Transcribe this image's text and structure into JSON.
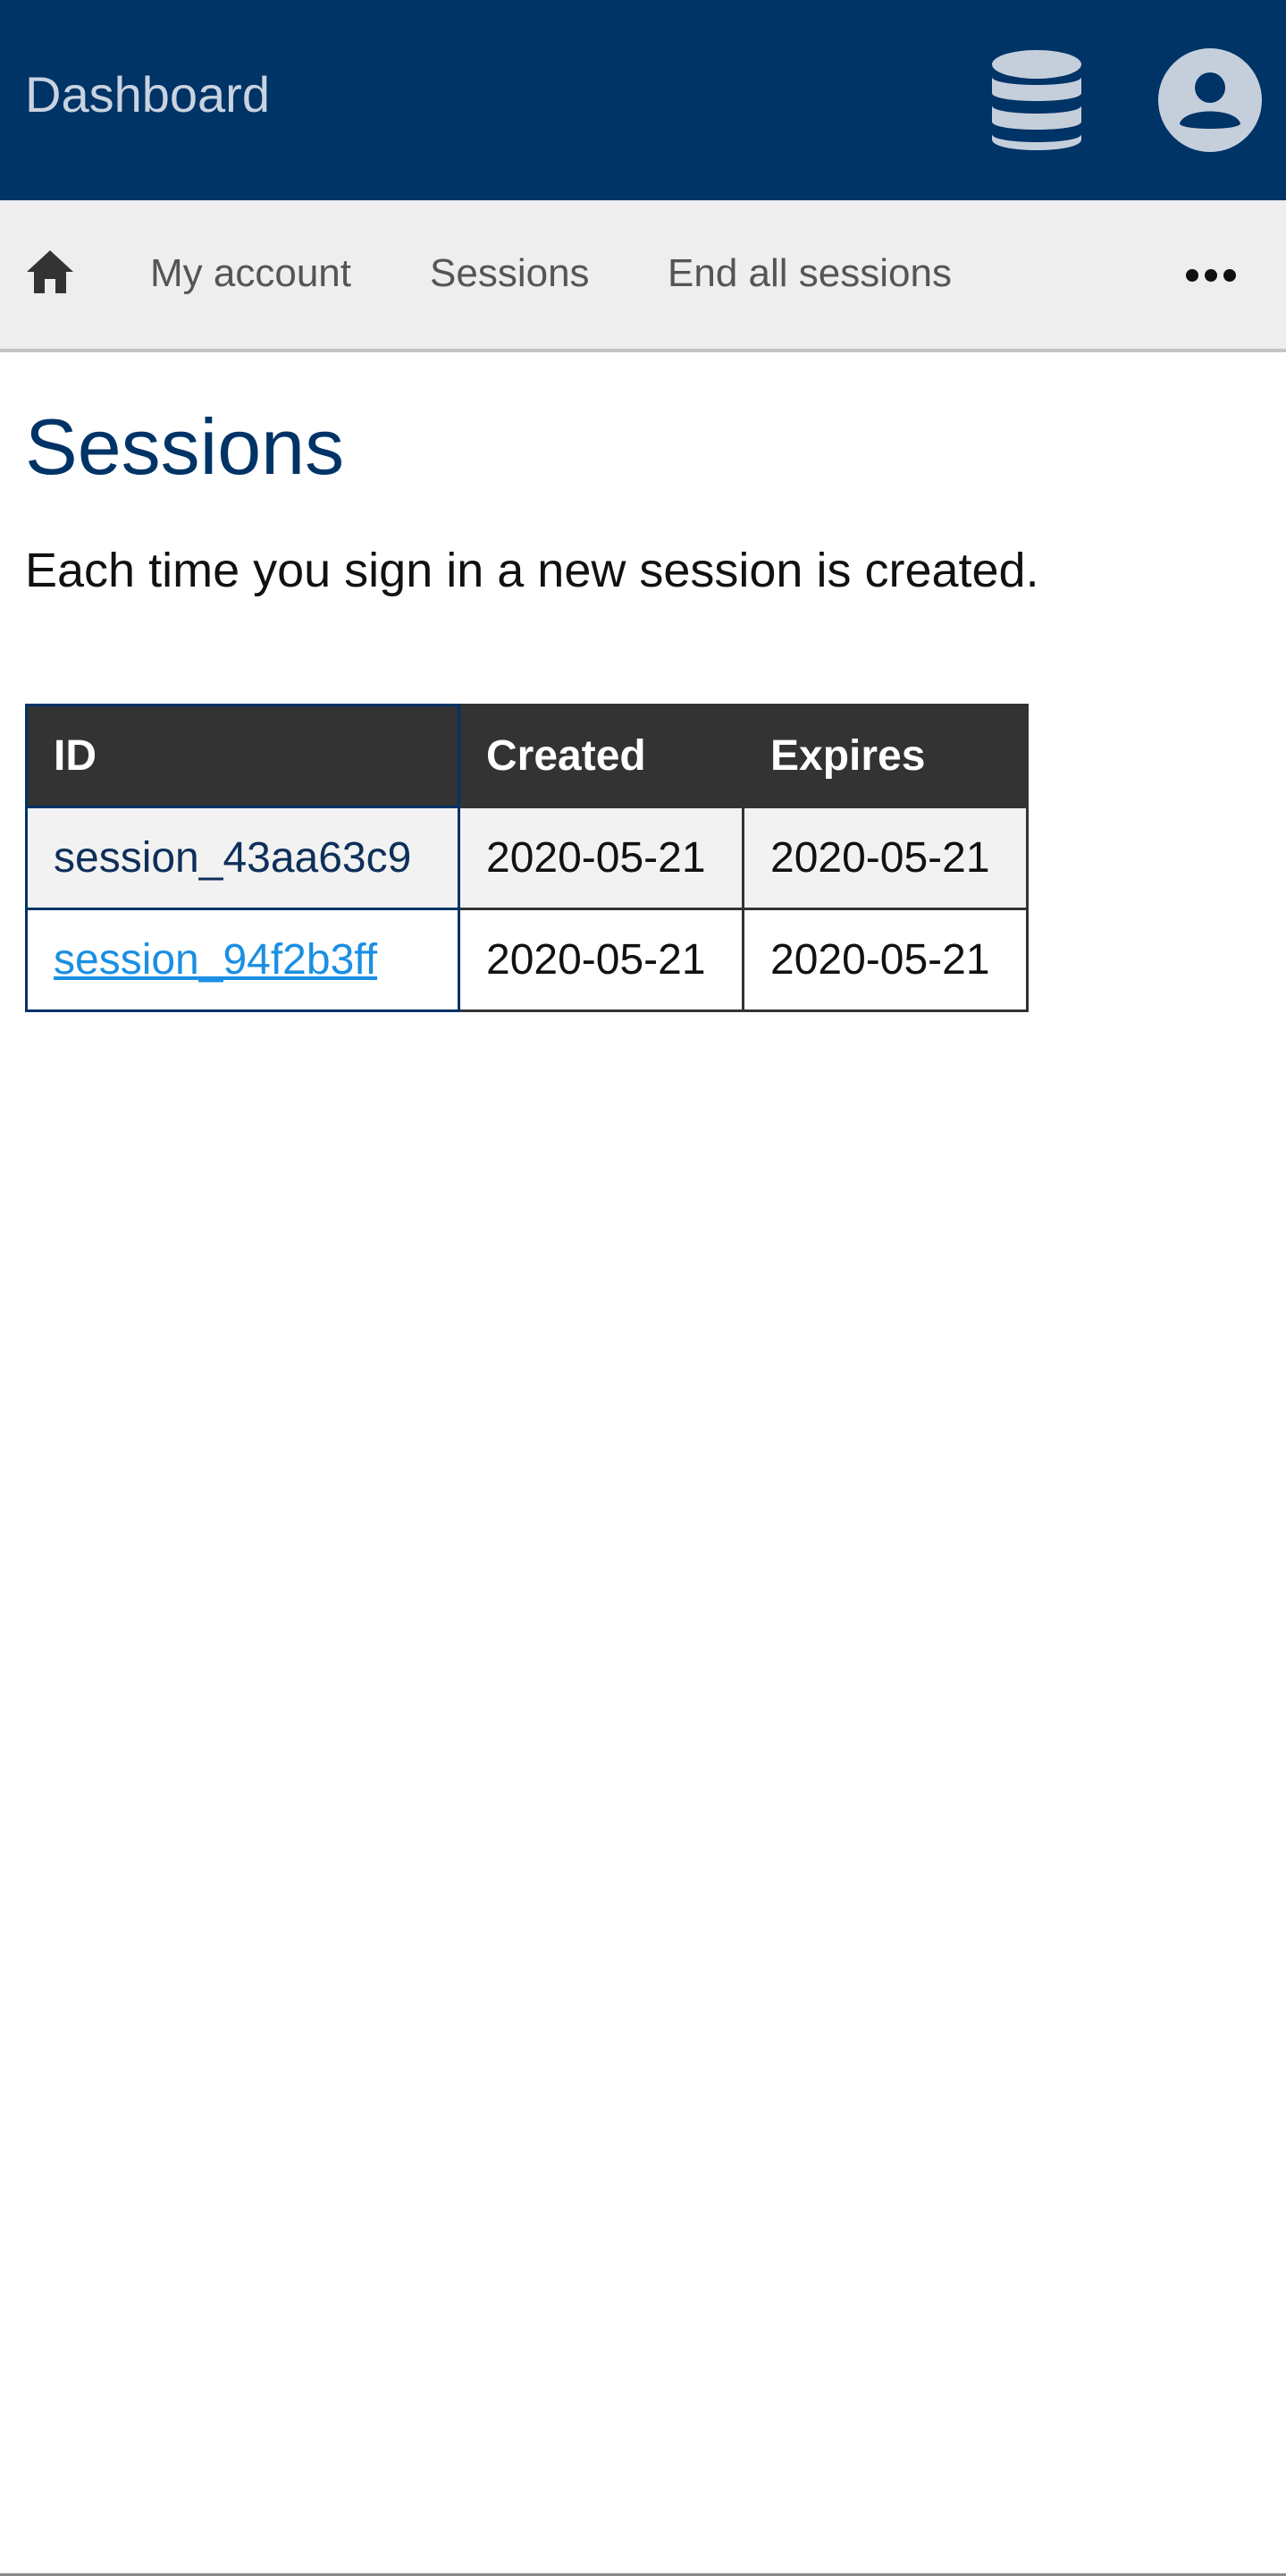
{
  "header": {
    "brand": "Dashboard",
    "database_icon": "database-icon",
    "user_icon": "user-circle-icon"
  },
  "nav": {
    "home_icon": "home-icon",
    "items": [
      {
        "label": "My account"
      },
      {
        "label": "Sessions"
      },
      {
        "label": "End all sessions"
      }
    ],
    "more_icon": "more-horizontal-icon"
  },
  "main": {
    "title": "Sessions",
    "intro": "Each time you sign in a new session is created."
  },
  "table": {
    "headers": [
      "ID",
      "Created",
      "Expires"
    ],
    "rows": [
      {
        "id": "session_43aa63c9",
        "created": "2020-05-21",
        "expires": "2020-05-21"
      },
      {
        "id": "session_94f2b3ff",
        "created": "2020-05-21",
        "expires": "2020-05-21"
      }
    ]
  },
  "colors": {
    "header_bg": "#003366",
    "nav_bg": "#eeeeee",
    "table_header_bg": "#333333",
    "link": "#1a8fe3",
    "title": "#003366"
  }
}
